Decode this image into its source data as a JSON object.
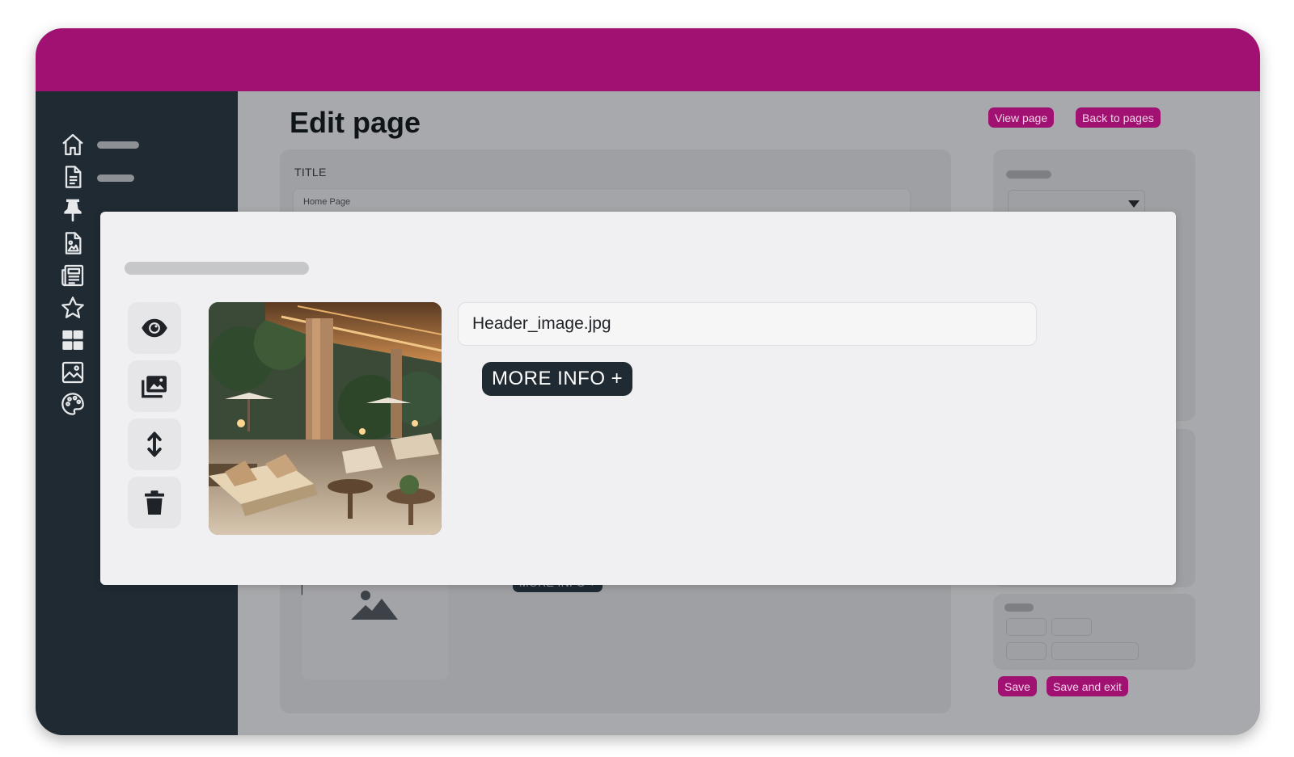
{
  "header": {
    "brand_color": "#a11172"
  },
  "sidebar": {
    "items": [
      {
        "icon": "home-icon"
      },
      {
        "icon": "document-icon"
      },
      {
        "icon": "pin-icon"
      },
      {
        "icon": "image-file-icon"
      },
      {
        "icon": "newspaper-icon"
      },
      {
        "icon": "star-icon"
      },
      {
        "icon": "grid-icon"
      },
      {
        "icon": "gallery-icon"
      },
      {
        "icon": "palette-icon"
      }
    ]
  },
  "page": {
    "title": "Edit page",
    "view_page_label": "View page",
    "back_label": "Back to pages",
    "title_field_label": "TITLE",
    "title_field_value": "Home Page",
    "save_label": "Save",
    "save_exit_label": "Save and exit",
    "bg_more_info_label": "MORE INFO +"
  },
  "modal": {
    "file_name": "Header_image.jpg",
    "more_info_label": "MORE INFO +",
    "tools": [
      "eye-icon",
      "gallery-icon",
      "move-vertical-icon",
      "trash-icon"
    ]
  }
}
